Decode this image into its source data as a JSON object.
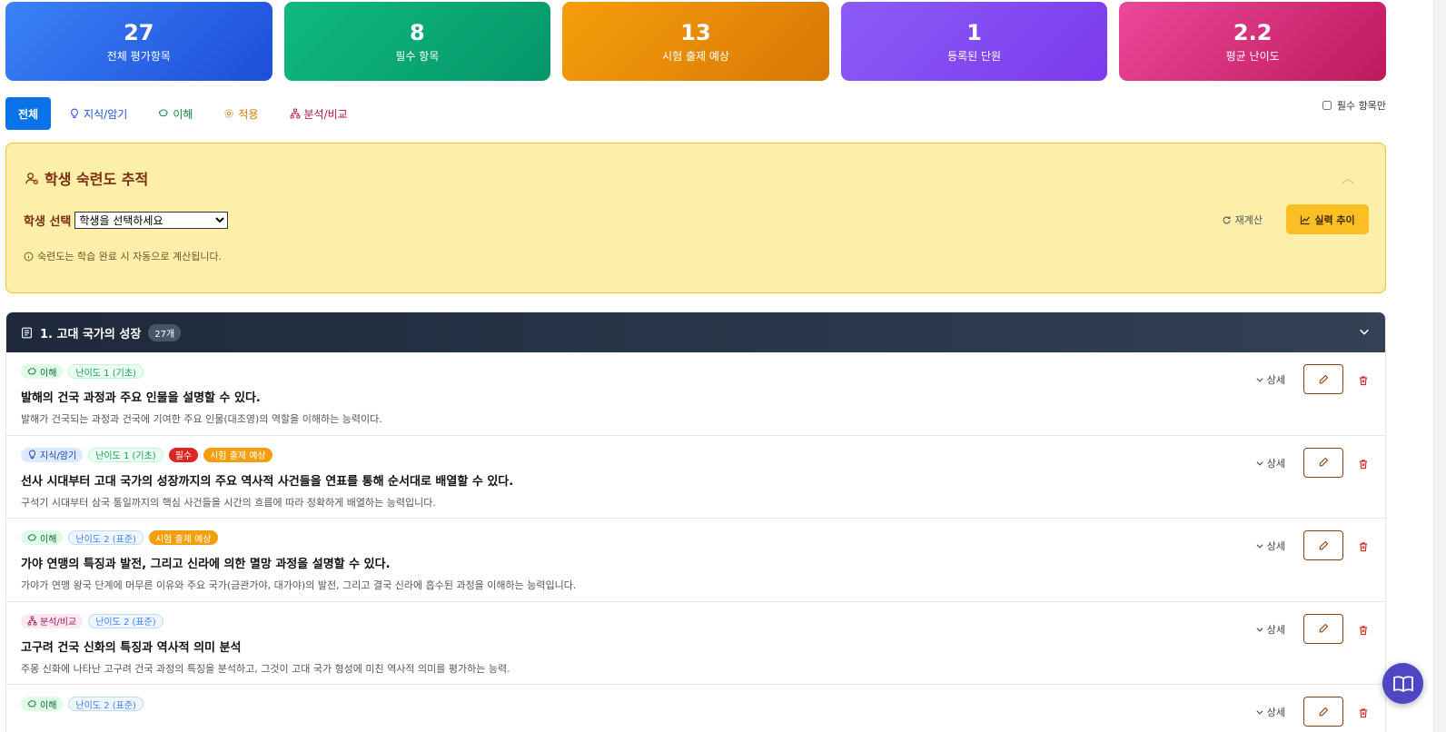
{
  "stats": [
    {
      "value": "27",
      "label": "전체 평가항목",
      "color_from": "#3b82f6",
      "color_to": "#1d4ed8"
    },
    {
      "value": "8",
      "label": "필수 항목",
      "color_from": "#10b981",
      "color_to": "#059669"
    },
    {
      "value": "13",
      "label": "시험 출제 예상",
      "color_from": "#f59e0b",
      "color_to": "#d97706"
    },
    {
      "value": "1",
      "label": "등록된 단원",
      "color_from": "#8b5cf6",
      "color_to": "#7c3aed"
    },
    {
      "value": "2.2",
      "label": "평균 난이도",
      "color_from": "#ec4899",
      "color_to": "#be185d"
    }
  ],
  "tabs": [
    {
      "label": "전체",
      "icon": "",
      "color": "#ffffff"
    },
    {
      "label": "지식/암기",
      "icon": "lightbulb-icon",
      "color": "#1d4ed8"
    },
    {
      "label": "이해",
      "icon": "brain-icon",
      "color": "#15803d"
    },
    {
      "label": "적용",
      "icon": "gear-icon",
      "color": "#d97706"
    },
    {
      "label": "분석/비교",
      "icon": "hierarchy-icon",
      "color": "#be123c"
    }
  ],
  "required_filter_label": "필수 항목만",
  "mastery": {
    "title": "학생 숙련도 추적",
    "select_label": "학생 선택",
    "select_value": "학생을 선택하세요",
    "recalc_label": "재계산",
    "trend_label": "실력 추이",
    "note": "숙련도는 학습 완료 시 자동으로 계산됩니다."
  },
  "unit": {
    "title": "1. 고대 국가의 성장",
    "count": "27개"
  },
  "detail_label": "상세",
  "items": [
    {
      "badges": [
        {
          "text": "이해",
          "kind": "understand"
        },
        {
          "text": "난이도 1 (기초)",
          "kind": "diff1"
        }
      ],
      "title": "발해의 건국 과정과 주요 인물을 설명할 수 있다.",
      "desc": "발해가 건국되는 과정과 건국에 기여한 주요 인물(대조영)의 역할을 이해하는 능력이다."
    },
    {
      "badges": [
        {
          "text": "지식/암기",
          "kind": "knowledge"
        },
        {
          "text": "난이도 1 (기초)",
          "kind": "diff1"
        },
        {
          "text": "필수",
          "kind": "req"
        },
        {
          "text": "시험 출제 예상",
          "kind": "exam"
        }
      ],
      "title": "선사 시대부터 고대 국가의 성장까지의 주요 역사적 사건들을 연표를 통해 순서대로 배열할 수 있다.",
      "desc": "구석기 시대부터 삼국 통일까지의 핵심 사건들을 시간의 흐름에 따라 정확하게 배열하는 능력입니다."
    },
    {
      "badges": [
        {
          "text": "이해",
          "kind": "understand"
        },
        {
          "text": "난이도 2 (표준)",
          "kind": "diff2"
        },
        {
          "text": "시험 출제 예상",
          "kind": "exam"
        }
      ],
      "title": "가야 연맹의 특징과 발전, 그리고 신라에 의한 멸망 과정을 설명할 수 있다.",
      "desc": "가야가 연맹 왕국 단계에 머무른 이유와 주요 국가(금관가야, 대가야)의 발전, 그리고 결국 신라에 흡수된 과정을 이해하는 능력입니다."
    },
    {
      "badges": [
        {
          "text": "분석/비교",
          "kind": "analysis"
        },
        {
          "text": "난이도 2 (표준)",
          "kind": "diff2"
        }
      ],
      "title": "고구려 건국 신화의 특징과 역사적 의미 분석",
      "desc": "주몽 신화에 나타난 고구려 건국 과정의 특징을 분석하고, 그것이 고대 국가 형성에 미친 역사적 의미를 평가하는 능력."
    },
    {
      "badges": [
        {
          "text": "이해",
          "kind": "understand"
        },
        {
          "text": "난이도 2 (표준)",
          "kind": "diff2"
        }
      ],
      "title": "",
      "desc": ""
    }
  ]
}
